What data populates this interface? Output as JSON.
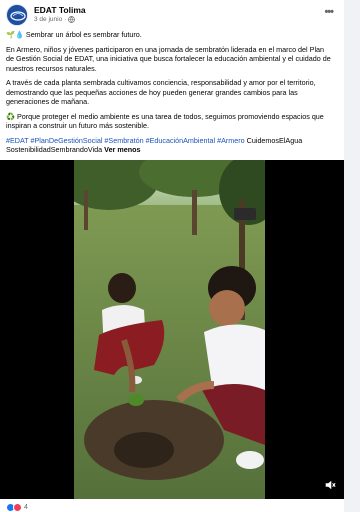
{
  "post": {
    "page_name": "EDAT Tolima",
    "date": "3 de junio",
    "paragraphs": [
      "🌱💧 Sembrar un árbol es sembrar futuro.",
      "En Armero, niños y jóvenes participaron en una jornada de sembratón liderada en el marco del Plan de Gestión Social de EDAT, una iniciativa que busca fortalecer la educación ambiental y el cuidado de nuestros recursos naturales.",
      "A través de cada planta sembrada cultivamos conciencia, responsabilidad y amor por el territorio, demostrando que las pequeñas acciones de hoy pueden generar grandes cambios para las generaciones de mañana.",
      "♻️ Porque proteger el medio ambiente es una tarea de todos, seguimos promoviendo espacios que inspiran a construir un futuro más sostenible."
    ],
    "hashtags": "#EDAT #PlanDeGestiónSocial #Sembratón #EducaciónAmbiental #Armero",
    "tail_text": " CuidemosElAgua SostenibilidadSembrandoVida ",
    "see_more": "Ver menos",
    "reaction_count": "4"
  },
  "icons": {
    "privacy": "globe-icon",
    "more": "more-options-icon",
    "mute": "speaker-mute-icon",
    "reactions": [
      "like-reaction-icon",
      "love-reaction-icon"
    ]
  },
  "colors": {
    "link": "#1b54b8",
    "like": "#1877f2",
    "love": "#f33e58",
    "secondary_text": "#65676b"
  }
}
